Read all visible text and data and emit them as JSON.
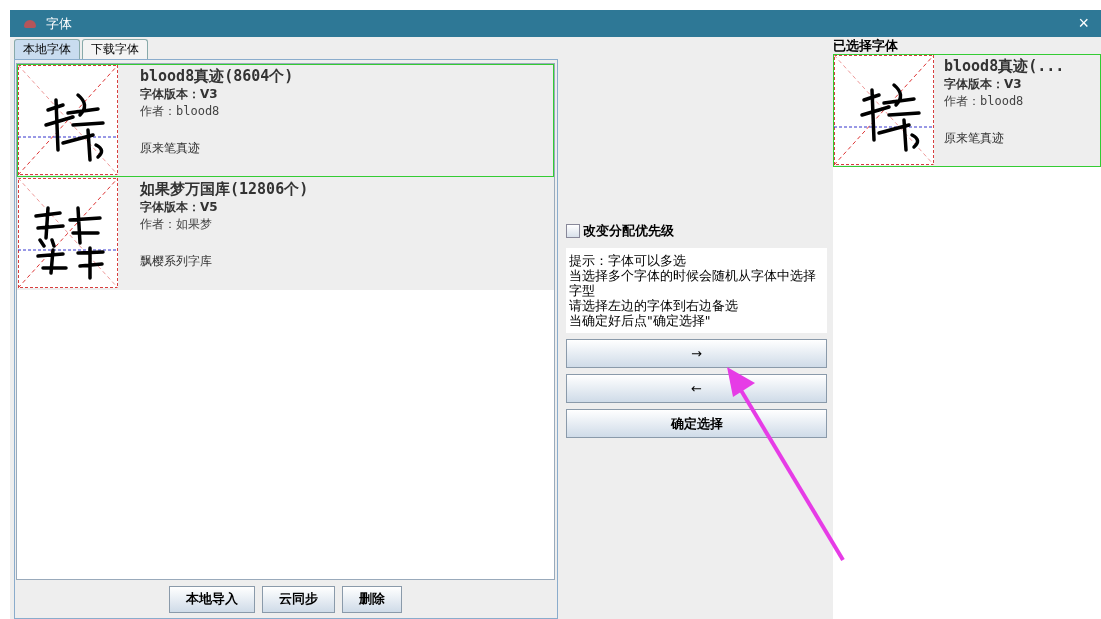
{
  "window": {
    "title": "字体",
    "close": "×"
  },
  "tabs": [
    {
      "label": "本地字体",
      "selected": true
    },
    {
      "label": "下载字体",
      "selected": false
    }
  ],
  "local_fonts": [
    {
      "name": "blood8真迹(8604个)",
      "version": "字体版本：V3",
      "author": "作者：blood8",
      "description": "原来笔真迹",
      "selected": true
    },
    {
      "name": "如果梦万国库(12806个)",
      "version": "字体版本：V5",
      "author": "作者：如果梦",
      "description": "飘樱系列字库",
      "selected": false
    }
  ],
  "local_buttons": [
    "本地导入",
    "云同步",
    "删除"
  ],
  "priority_checkbox": {
    "label": "改变分配优先级",
    "checked": false
  },
  "hint": [
    "提示：字体可以多选",
    "当选择多个字体的时候会随机从字体中选择字型",
    "请选择左边的字体到右边备选",
    "当确定好后点\"确定选择\""
  ],
  "move_buttons": [
    "→",
    "←",
    "确定选择"
  ],
  "selected_fonts": {
    "label": "已选择字体",
    "items": [
      {
        "name": "blood8真迹(...",
        "version": "字体版本：V3",
        "author": "作者：blood8",
        "description": "原来笔真迹",
        "selected": true
      }
    ]
  }
}
